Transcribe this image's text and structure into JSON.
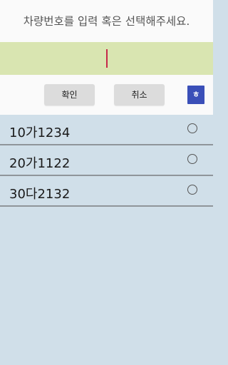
{
  "header": {
    "prompt": "차량번호를 입력 혹은 선택해주세요."
  },
  "input": {
    "value": ""
  },
  "toolbar": {
    "confirm_label": "확인",
    "cancel_label": "취소",
    "keyboard_label": "ㅎ"
  },
  "vehicles": [
    {
      "plate": "10가1234",
      "selected": false
    },
    {
      "plate": "20가1122",
      "selected": false
    },
    {
      "plate": "30다2132",
      "selected": false
    }
  ],
  "colors": {
    "input_bg": "#d9e5b1",
    "list_bg": "#d0dfe9",
    "cursor": "#c62848",
    "keyboard_button": "#3a4fb8"
  }
}
